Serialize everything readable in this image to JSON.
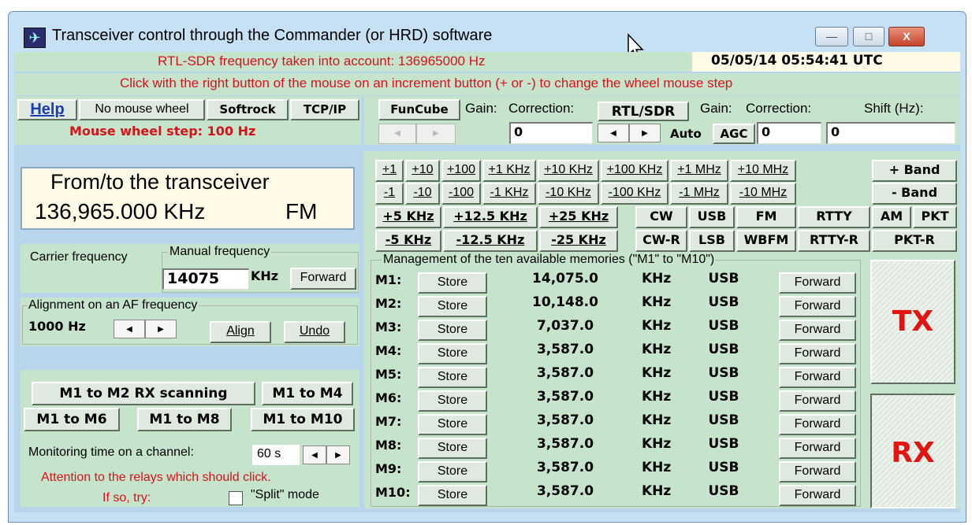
{
  "window": {
    "title": "Transceiver control through the Commander (or HRD) software",
    "minimize": "—",
    "maximize": "□",
    "close": "X"
  },
  "status": {
    "rtl_frequency": "RTL-SDR frequency taken into account: 136965000 Hz",
    "datetime": "05/05/14 05:54:41 UTC",
    "hint": "Click with the right button of the mouse on an increment button (+ or -) to change the wheel mouse step"
  },
  "toolbar": {
    "help": "Help",
    "no_mouse_wheel": "No mouse wheel",
    "softrock": "Softrock",
    "tcpip": "TCP/IP",
    "wheel_step": "Mouse wheel step: 100 Hz",
    "funcube": "FunCube",
    "fc_gain": "Gain:",
    "fc_correction": "Correction:",
    "fc_correction_value": "0",
    "rtlsdr": "RTL/SDR",
    "rtl_gain": "Gain:",
    "rtl_correction": "Correction:",
    "auto": "Auto",
    "agc": "AGC",
    "agc_value": "0",
    "shift_label": "Shift (Hz):",
    "shift_value": "0"
  },
  "transceiver": {
    "heading": "From/to the transceiver",
    "frequency": "136,965.000 KHz",
    "mode": "FM",
    "carrier_label": "Carrier frequency",
    "manual_group": "Manual frequency",
    "manual_value": "14075",
    "manual_unit": "KHz",
    "forward": "Forward"
  },
  "alignment": {
    "group": "Alignment on an AF frequency",
    "value": "1000 Hz",
    "align": "Align",
    "undo": "Undo"
  },
  "scanning": {
    "m1_m2": "M1 to M2 RX scanning",
    "m1_m4": "M1 to M4",
    "m1_m6": "M1 to M6",
    "m1_m8": "M1 to M8",
    "m1_m10": "M1 to M10",
    "monitor_label": "Monitoring time on a channel:",
    "monitor_value": "60 s",
    "relay_warning": "Attention to the relays which should click.",
    "if_so": "If so, try:",
    "split": "\"Split\" mode"
  },
  "increments": {
    "plus": [
      "+1",
      "+10",
      "+100",
      "+1 KHz",
      "+10 KHz",
      "+100 KHz",
      "+1 MHz",
      "+10 MHz"
    ],
    "minus": [
      "-1",
      "-10",
      "-100",
      "-1 KHz",
      "-10 KHz",
      "-100 KHz",
      "-1 MHz",
      "-10 MHz"
    ],
    "plus_band": "+ Band",
    "minus_band": "- Band",
    "steps_plus": [
      "+5 KHz",
      "+12.5 KHz",
      "+25 KHz"
    ],
    "steps_minus": [
      "-5 KHz",
      "-12.5 KHz",
      "-25 KHz"
    ]
  },
  "modes": {
    "row1": [
      "CW",
      "USB",
      "FM",
      "RTTY",
      "AM",
      "PKT"
    ],
    "row2": [
      "CW-R",
      "LSB",
      "WBFM",
      "RTTY-R",
      "PKT-R"
    ]
  },
  "memories": {
    "group": "Management of the ten available memories (\"M1\" to \"M10\")",
    "store": "Store",
    "forward": "Forward",
    "unit": "KHz",
    "rows": [
      {
        "label": "M1:",
        "freq": "14,075.0",
        "mode": "USB"
      },
      {
        "label": "M2:",
        "freq": "10,148.0",
        "mode": "USB"
      },
      {
        "label": "M3:",
        "freq": "7,037.0",
        "mode": "USB"
      },
      {
        "label": "M4:",
        "freq": "3,587.0",
        "mode": "USB"
      },
      {
        "label": "M5:",
        "freq": "3,587.0",
        "mode": "USB"
      },
      {
        "label": "M6:",
        "freq": "3,587.0",
        "mode": "USB"
      },
      {
        "label": "M7:",
        "freq": "3,587.0",
        "mode": "USB"
      },
      {
        "label": "M8:",
        "freq": "3,587.0",
        "mode": "USB"
      },
      {
        "label": "M9:",
        "freq": "3,587.0",
        "mode": "USB"
      },
      {
        "label": "M10:",
        "freq": "3,587.0",
        "mode": "USB"
      }
    ]
  },
  "tx": "TX",
  "rx": "RX"
}
